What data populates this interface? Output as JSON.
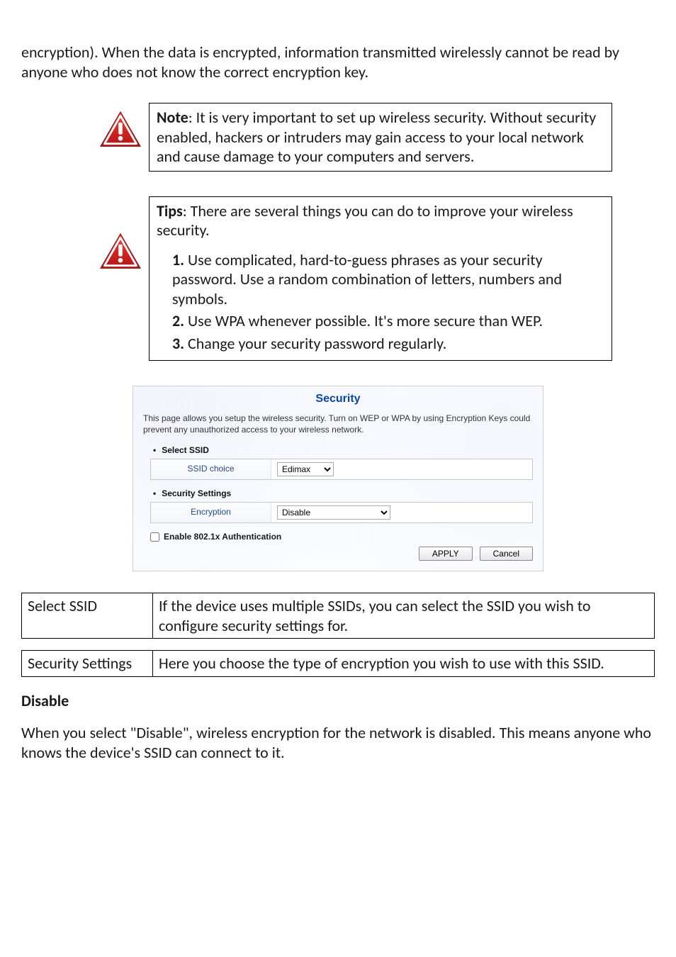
{
  "intro_para": "encryption). When the data is encrypted, information transmitted wirelessly cannot be read by anyone who does not know the correct encryption key.",
  "note": {
    "label": "Note",
    "text": ": It is very important to set up wireless security. Without security enabled, hackers or intruders may gain access to your local network and cause damage to your computers and servers."
  },
  "tips": {
    "label": "Tips",
    "lead": ": There are several things you can do to improve your wireless security.",
    "items": [
      "Use complicated, hard-to-guess phrases as your security password. Use a random combination of letters, numbers and symbols.",
      "Use WPA whenever possible. It's more secure than WEP.",
      "Change your security password regularly."
    ]
  },
  "panel": {
    "title": "Security",
    "description": "This page allows you setup the wireless security. Turn on WEP or WPA by using Encryption Keys could prevent any unauthorized access to your wireless network.",
    "select_ssid_header": "Select SSID",
    "ssid_choice_label": "SSID choice",
    "ssid_choice_value": "Edimax",
    "security_settings_header": "Security Settings",
    "encryption_label": "Encryption",
    "encryption_value": "Disable",
    "auth_checkbox_label": "Enable 802.1x Authentication",
    "apply_btn": "APPLY",
    "cancel_btn": "Cancel"
  },
  "tbl1": {
    "k": "Select SSID",
    "v": "If the device uses multiple SSIDs, you can select the SSID you wish to configure security settings for."
  },
  "tbl2": {
    "k": "Security Settings",
    "v": "Here you choose the type of encryption you wish to use with this SSID."
  },
  "disable_header": "Disable",
  "disable_para": "When you select \"Disable\", wireless encryption for the network is disabled. This means anyone who knows the device's SSID can connect to it."
}
